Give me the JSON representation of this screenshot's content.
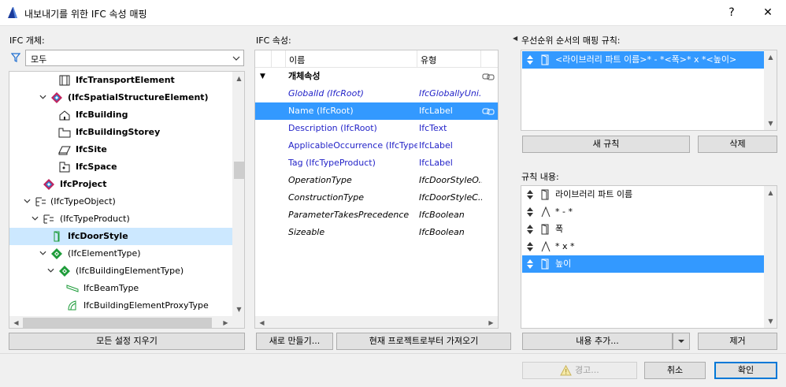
{
  "window": {
    "title": "내보내기를 위한 IFC 속성 매핑",
    "help": "?",
    "close": "✕"
  },
  "left": {
    "label": "IFC 개체:",
    "filter_value": "모두",
    "clear_button": "모든 설정 지우기",
    "tree": [
      {
        "text": "IfcTransportElement",
        "bold": true,
        "icon": "transport-element-icon"
      },
      {
        "text": "(IfcSpatialStructureElement)",
        "bold": true,
        "icon": "spatial-structure-icon",
        "chev": "⌄"
      },
      {
        "text": "IfcBuilding",
        "bold": true,
        "icon": "building-icon"
      },
      {
        "text": "IfcBuildingStorey",
        "bold": true,
        "icon": "storey-icon"
      },
      {
        "text": "IfcSite",
        "bold": true,
        "icon": "site-icon"
      },
      {
        "text": "IfcSpace",
        "bold": true,
        "icon": "space-icon"
      },
      {
        "text": "IfcProject",
        "bold": true,
        "icon": "project-icon"
      },
      {
        "text": "(IfcTypeObject)",
        "bold": false,
        "icon": "type-object-icon",
        "chev": "⌄"
      },
      {
        "text": "(IfcTypeProduct)",
        "bold": false,
        "icon": "type-product-icon",
        "chev": "⌄"
      },
      {
        "text": "IfcDoorStyle",
        "bold": true,
        "icon": "door-style-icon",
        "selected": true
      },
      {
        "text": "(IfcElementType)",
        "bold": false,
        "icon": "element-type-icon",
        "chev": "⌄"
      },
      {
        "text": "(IfcBuildingElementType)",
        "bold": false,
        "icon": "building-element-type-icon",
        "chev": "⌄"
      },
      {
        "text": "IfcBeamType",
        "bold": false,
        "icon": "beam-type-icon"
      },
      {
        "text": "IfcBuildingElementProxyType",
        "bold": false,
        "icon": "proxy-type-icon"
      }
    ]
  },
  "middle": {
    "label": "IFC 속성:",
    "col_name": "이름",
    "col_type": "유형",
    "group": "개체속성",
    "rows": [
      {
        "name": "GlobalId (IfcRoot)",
        "type": "IfcGloballyUni...",
        "style": "blue-italic",
        "link": false
      },
      {
        "name": "Name (IfcRoot)",
        "type": "IfcLabel",
        "style": "blue",
        "selected": true,
        "link": true
      },
      {
        "name": "Description (IfcRoot)",
        "type": "IfcText",
        "style": "blue",
        "link": false
      },
      {
        "name": "ApplicableOccurrence (IfcType...",
        "type": "IfcLabel",
        "style": "blue",
        "link": false
      },
      {
        "name": "Tag (IfcTypeProduct)",
        "type": "IfcLabel",
        "style": "blue",
        "link": false
      },
      {
        "name": "OperationType",
        "type": "IfcDoorStyleO...",
        "style": "italic",
        "link": false
      },
      {
        "name": "ConstructionType",
        "type": "IfcDoorStyleC...",
        "style": "italic",
        "link": false
      },
      {
        "name": "ParameterTakesPrecedence",
        "type": "IfcBoolean",
        "style": "italic",
        "link": false
      },
      {
        "name": "Sizeable",
        "type": "IfcBoolean",
        "style": "italic",
        "link": false
      }
    ],
    "new_button": "새로 만들기...",
    "import_button": "현재 프로젝트로부터 가져오기"
  },
  "right": {
    "rules_label": "우선순위 순서의 매핑 규칙:",
    "rules": [
      {
        "text": "<라이브러리 파트 이름>* - *<폭>* x *<높이>",
        "selected": true
      }
    ],
    "new_rule_button": "새 규칙",
    "delete_button": "삭제",
    "content_label": "규칙 내용:",
    "content": [
      {
        "text": "라이브러리 파트 이름",
        "icon": "door-icon"
      },
      {
        "text": "* - *",
        "icon": "text-a-icon"
      },
      {
        "text": "폭",
        "icon": "door-icon"
      },
      {
        "text": "* x *",
        "icon": "text-a-icon"
      },
      {
        "text": "높이",
        "icon": "door-icon",
        "selected": true
      }
    ],
    "add_content_button": "내용 추가...",
    "remove_button": "제거"
  },
  "footer": {
    "warning_button": "경고...",
    "cancel_button": "취소",
    "ok_button": "확인"
  },
  "colors": {
    "selection": "#3399ff",
    "tree_selection": "#cce8ff",
    "ifc_blue": "#2323c8",
    "accent": "#0078d7"
  }
}
